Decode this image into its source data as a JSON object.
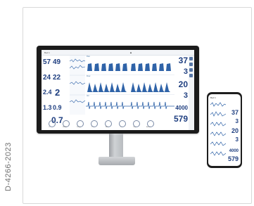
{
  "side_label": "D-4266-2023",
  "monitor": {
    "topbar_title": "Bed 1",
    "topbar_mid": "▲",
    "left_values": [
      "57",
      "49",
      "24",
      "22",
      "2.4",
      "2",
      "1.3",
      "0.9",
      "0.7"
    ],
    "right_values": [
      "37",
      "3",
      "20",
      "3",
      "4000",
      "579"
    ],
    "wave_labels": [
      "Paw",
      "Flow",
      "Vol"
    ],
    "bottom_buttons": [
      "O₂",
      "PEEP",
      "Pinsp",
      "VT",
      "RR",
      "Ti",
      "Trig",
      "Alarm"
    ]
  },
  "phone": {
    "title": "Bed 1",
    "values": [
      "37",
      "3",
      "20",
      "3",
      "4000",
      "579"
    ]
  },
  "colors": {
    "value_blue": "#1f3f80",
    "wave_blue": "#2f63a8",
    "bezel": "#1b1b1b"
  }
}
